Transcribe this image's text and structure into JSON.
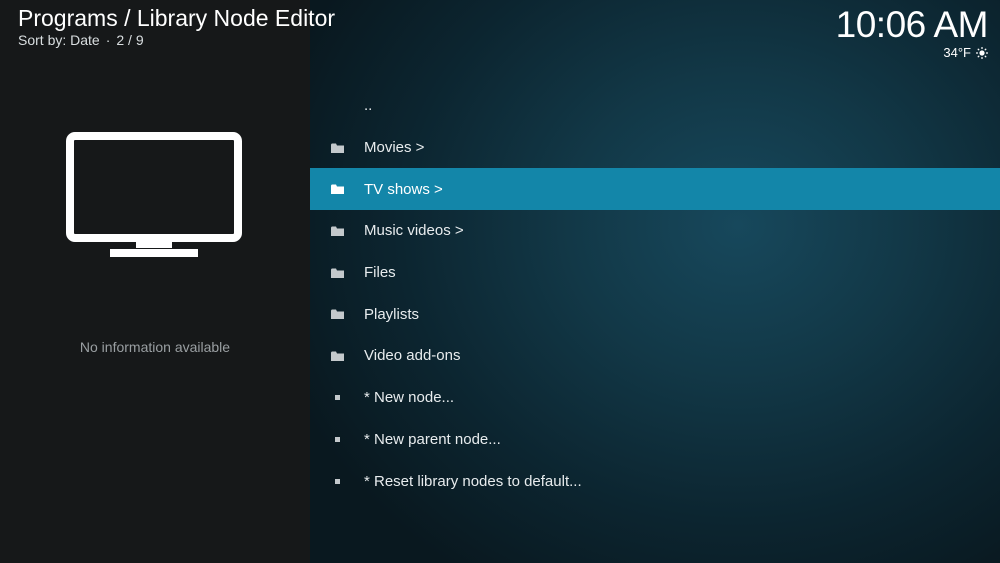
{
  "header": {
    "title": "Programs / Library Node Editor",
    "sort_label": "Sort by: Date",
    "position": "2 / 9"
  },
  "clock": {
    "time": "10:06 AM",
    "temperature": "34°F",
    "weather_icon": "sun-icon"
  },
  "info_panel": {
    "artwork_icon": "tv-icon",
    "message": "No information available"
  },
  "list": {
    "items": [
      {
        "label": "..",
        "icon": "none",
        "selected": false
      },
      {
        "label": "Movies >",
        "icon": "folder-icon",
        "selected": false
      },
      {
        "label": "TV shows >",
        "icon": "folder-icon",
        "selected": true
      },
      {
        "label": "Music videos >",
        "icon": "folder-icon",
        "selected": false
      },
      {
        "label": "Files",
        "icon": "folder-icon",
        "selected": false
      },
      {
        "label": "Playlists",
        "icon": "folder-icon",
        "selected": false
      },
      {
        "label": "Video add-ons",
        "icon": "folder-icon",
        "selected": false
      },
      {
        "label": "* New node...",
        "icon": "bullet-icon",
        "selected": false
      },
      {
        "label": "* New parent node...",
        "icon": "bullet-icon",
        "selected": false
      },
      {
        "label": "* Reset library nodes to default...",
        "icon": "bullet-icon",
        "selected": false
      }
    ]
  },
  "colors": {
    "selection": "#1386a9",
    "left_panel": "#161819",
    "background": "#123847"
  }
}
